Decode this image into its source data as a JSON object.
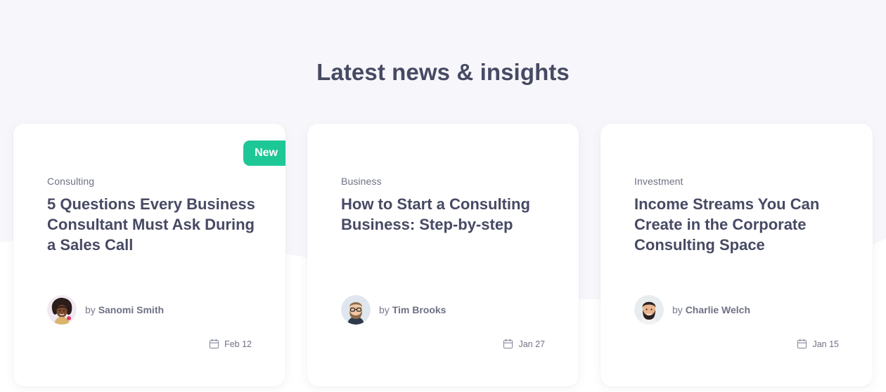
{
  "section": {
    "title": "Latest news & insights"
  },
  "posts": [
    {
      "badge": "New",
      "category": "Consulting",
      "title": "5 Questions Every Business Consultant Must Ask During a Sales Call",
      "by": "by",
      "author": "Sanomi Smith",
      "date": "Feb 12",
      "avatar_icon": "woman-avatar-icon"
    },
    {
      "category": "Business",
      "title": "How to Start a Consulting Business: Step-by-step",
      "by": "by",
      "author": "Tim Brooks",
      "date": "Jan 27",
      "avatar_icon": "man-glasses-avatar-icon"
    },
    {
      "category": "Investment",
      "title": "Income Streams You Can Create in the Corporate Consulting Space",
      "by": "by",
      "author": "Charlie Welch",
      "date": "Jan 15",
      "avatar_icon": "man-beard-avatar-icon"
    }
  ],
  "colors": {
    "page_background": "#f7f7fb",
    "title_text": "#474a63",
    "badge_background": "#1dc896",
    "muted_text": "#6e7185",
    "card_background": "#ffffff"
  }
}
